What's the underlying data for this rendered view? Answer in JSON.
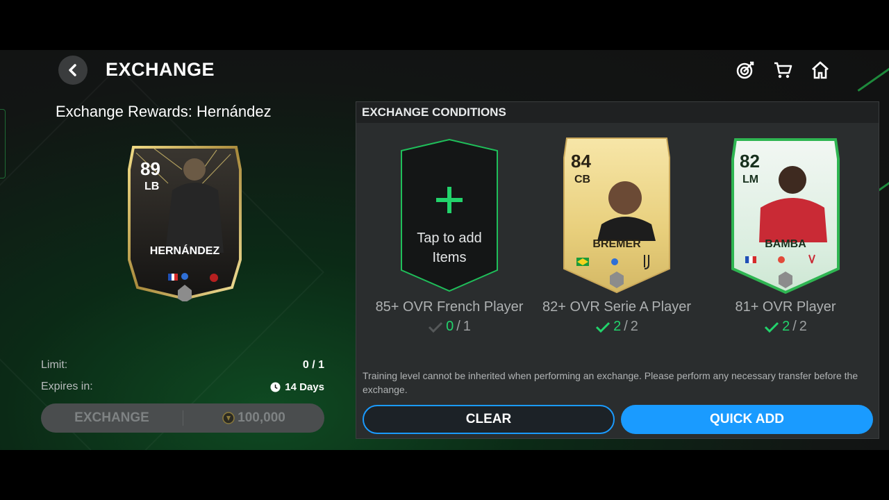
{
  "header": {
    "title": "EXCHANGE"
  },
  "reward": {
    "title": "Exchange Rewards:  Hernández",
    "card": {
      "ovr": "89",
      "position": "LB",
      "name": "HERNÁNDEZ"
    }
  },
  "limit": {
    "label": "Limit:",
    "value": "0 / 1"
  },
  "expires": {
    "label": "Expires in:",
    "value": "14 Days"
  },
  "exchange_button": {
    "label": "EXCHANGE",
    "cost": "100,000"
  },
  "panel": {
    "heading": "EXCHANGE CONDITIONS",
    "add_slot": {
      "line1": "Tap to add",
      "line2": "Items"
    },
    "conditions": [
      {
        "label": "85+ OVR French Player",
        "have": "0",
        "need": "1",
        "met": false
      },
      {
        "label": "82+ OVR Serie A Player",
        "have": "2",
        "need": "2",
        "met": true,
        "card": {
          "ovr": "84",
          "position": "CB",
          "name": "BREMER"
        }
      },
      {
        "label": "81+ OVR Player",
        "have": "2",
        "need": "2",
        "met": true,
        "card": {
          "ovr": "82",
          "position": "LM",
          "name": "BAMBA"
        }
      }
    ],
    "note": "Training level cannot be inherited when performing an exchange. Please perform any necessary transfer before the exchange.",
    "clear_label": "CLEAR",
    "quick_add_label": "QUICK ADD"
  },
  "colors": {
    "accent_blue": "#1a9bff",
    "check_green": "#22d36b",
    "gold_card": "#e7cf82",
    "green_card": "#2fb552"
  },
  "icons": [
    "back-icon",
    "objectives-icon",
    "store-icon",
    "home-icon",
    "clock-icon",
    "coin-icon",
    "plus-icon",
    "check-icon"
  ]
}
